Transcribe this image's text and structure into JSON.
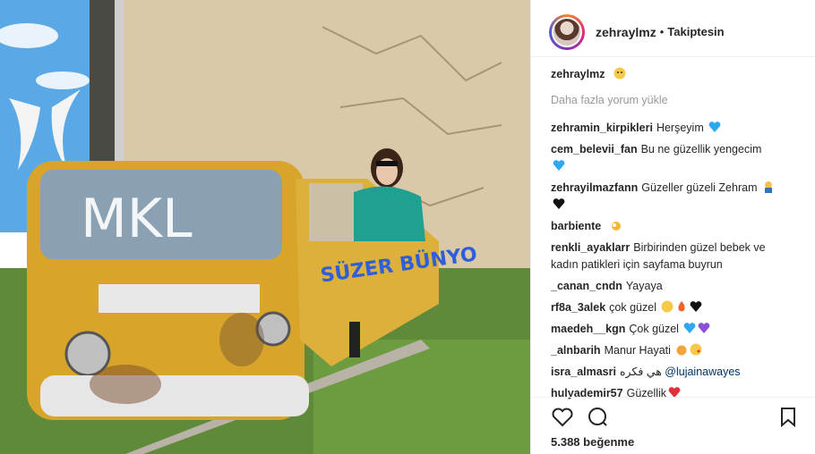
{
  "post": {
    "username": "zehraylmz",
    "following_label": "Takiptesin",
    "caption_user": "zehraylmz",
    "load_more": "Daha fazla yorum yükle",
    "likes": "5.388 beğenme",
    "photo_text": "SÜZER BÜNYO"
  },
  "comments": [
    {
      "user": "zehramin_kirpikleri",
      "text": "Herşeyim",
      "emoji": "blue-heart-icon"
    },
    {
      "user": "cem_belevii_fan",
      "text": "Bu ne güzellik yengecim",
      "emoji": "blue-heart-icon"
    },
    {
      "user": "zehrayilmazfann",
      "text": "Güzeller güzeli Zehram",
      "emoji": "praying-icon"
    },
    {
      "user": "barbiente",
      "text": "",
      "emoji": "ok-hand-icon"
    },
    {
      "user": "renkli_ayaklarr",
      "text": "Birbirinden güzel bebek ve kadın patikleri için sayfama buyrun",
      "emoji": ""
    },
    {
      "user": "_canan_cndn",
      "text": "Yayaya",
      "emoji": ""
    },
    {
      "user": "rf8a_3alek",
      "text": "çok güzel",
      "emoji": "smile-fire-heart-icon"
    },
    {
      "user": "maedeh__kgn",
      "text": "Çok güzel",
      "emoji": "blue-purple-heart-icon"
    },
    {
      "user": "_alnbarih",
      "text": "Manur Hayati",
      "emoji": "cat-kiss-icon"
    },
    {
      "user": "isra_almasri",
      "text": "هي فكره",
      "mention": "@lujainawayes"
    },
    {
      "user": "hulyademir57",
      "text": "Güzellik",
      "emoji": "red-heart-icon"
    }
  ],
  "colors": {
    "accent_link": "#003569",
    "muted": "#999999"
  }
}
